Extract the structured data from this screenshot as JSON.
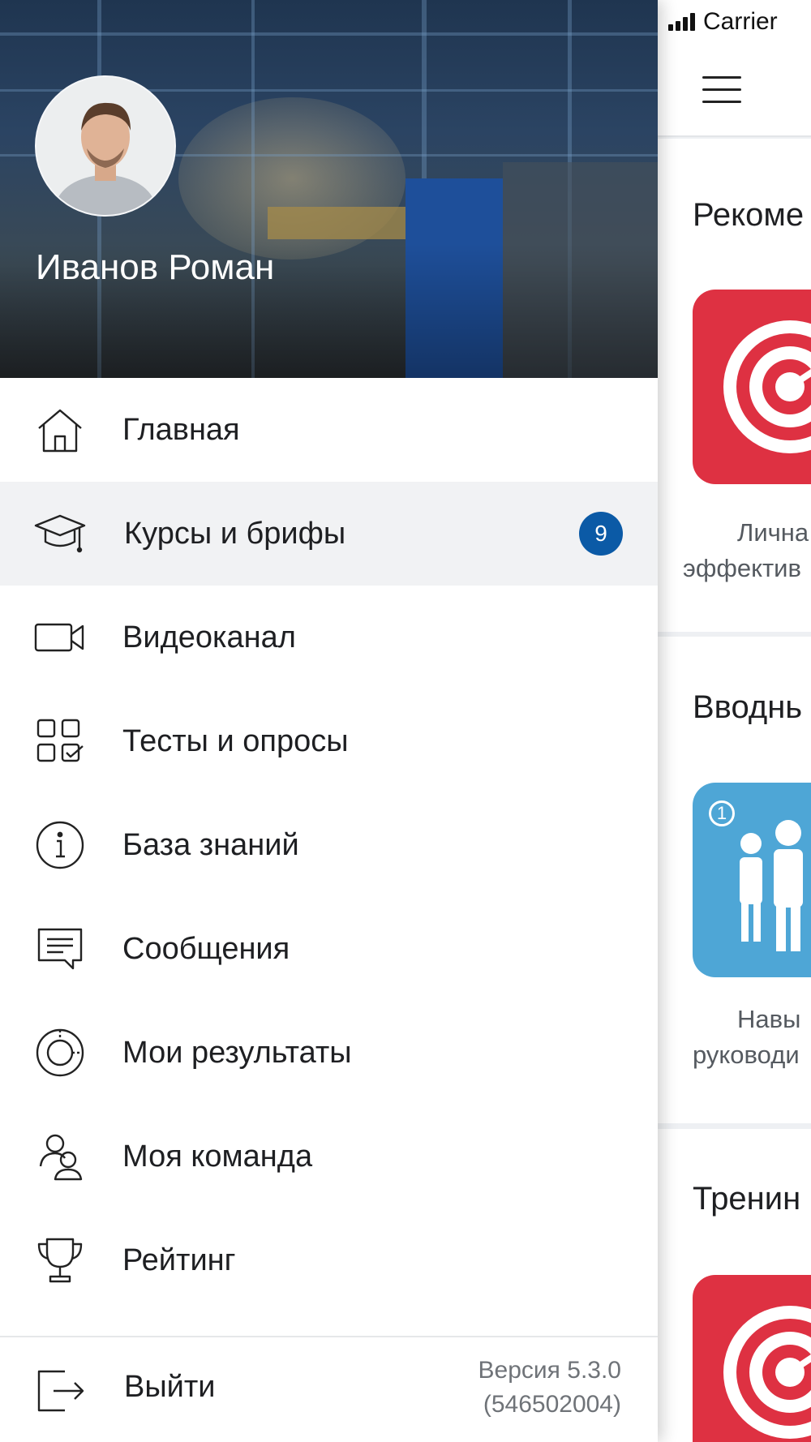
{
  "status_bar": {
    "carrier": "Carrier"
  },
  "app": {
    "sections": [
      {
        "title": "Рекоме",
        "caption_line1": "Лична",
        "caption_line2": "эффектив"
      },
      {
        "title": "Вводнь",
        "caption_line1": "Навы",
        "caption_line2": "руководи",
        "card_number": "1"
      },
      {
        "title": "Тренин"
      }
    ]
  },
  "drawer": {
    "user_name": "Иванов Роман",
    "menu": [
      {
        "label": "Главная",
        "icon": "home-icon"
      },
      {
        "label": "Курсы и брифы",
        "icon": "graduation-cap-icon",
        "badge": "9",
        "active": true
      },
      {
        "label": "Видеоканал",
        "icon": "video-camera-icon"
      },
      {
        "label": "Тесты и опросы",
        "icon": "tests-grid-icon"
      },
      {
        "label": "База знаний",
        "icon": "info-icon"
      },
      {
        "label": "Сообщения",
        "icon": "message-icon"
      },
      {
        "label": "Мои результаты",
        "icon": "results-chart-icon"
      },
      {
        "label": "Моя команда",
        "icon": "team-icon"
      },
      {
        "label": "Рейтинг",
        "icon": "trophy-icon"
      }
    ],
    "logout_label": "Выйти",
    "version_line1": "Версия 5.3.0",
    "version_line2": "(546502004)"
  },
  "colors": {
    "badge": "#0b5aa6",
    "active_item_bg": "#f1f2f4",
    "card_red": "#de3142",
    "card_blue": "#4ea6d6"
  }
}
